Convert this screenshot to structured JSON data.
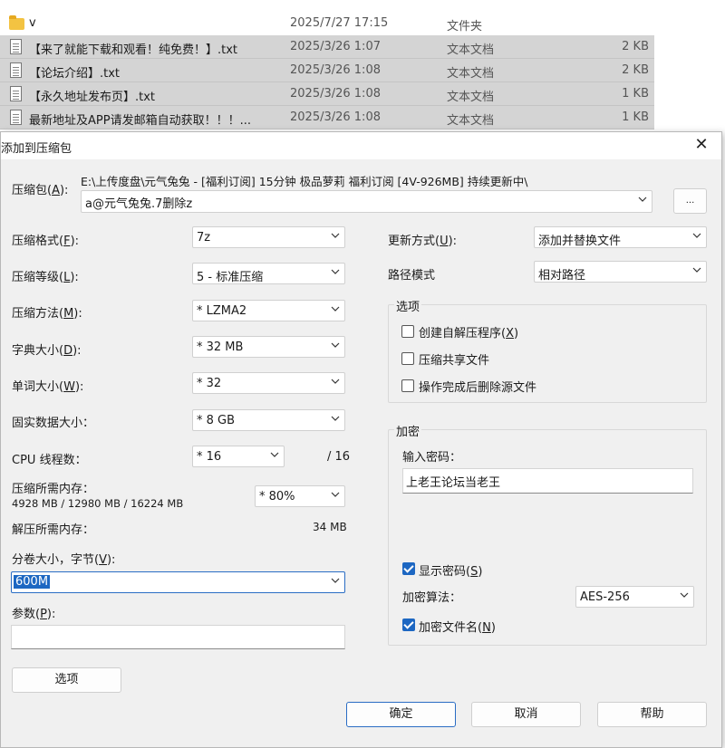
{
  "explorer": {
    "folder": {
      "name": "v",
      "date": "2025/7/27 17:15",
      "type": "文件夹",
      "size": ""
    },
    "files": [
      {
        "name": "【来了就能下载和观看！纯免费！】.txt",
        "date": "2025/3/26 1:07",
        "type": "文本文档",
        "size": "2 KB"
      },
      {
        "name": "【论坛介绍】.txt",
        "date": "2025/3/26 1:08",
        "type": "文本文档",
        "size": "2 KB"
      },
      {
        "name": "【永久地址发布页】.txt",
        "date": "2025/3/26 1:08",
        "type": "文本文档",
        "size": "1 KB"
      },
      {
        "name": "最新地址及APP请发邮箱自动获取！！！...",
        "date": "2025/3/26 1:08",
        "type": "文本文档",
        "size": "1 KB"
      }
    ]
  },
  "dialog": {
    "title": "添加到压缩包",
    "archive": {
      "label_pre": "压缩包(",
      "label_key": "A",
      "label_post": "):",
      "path": "E:\\上传度盘\\元气兔兔 - [福利订阅] 15分钟 极品萝莉 福利订阅 [4V-926MB] 持续更新中\\",
      "filename": "a@元气兔兔.7删除z",
      "browse": "..."
    },
    "left": {
      "format": {
        "label_pre": "压缩格式(",
        "label_key": "F",
        "label_post": "):",
        "value": "7z"
      },
      "level": {
        "label_pre": "压缩等级(",
        "label_key": "L",
        "label_post": "):",
        "value": "5 - 标准压缩"
      },
      "method": {
        "label_pre": "压缩方法(",
        "label_key": "M",
        "label_post": "):",
        "value": "* LZMA2"
      },
      "dict": {
        "label_pre": "字典大小(",
        "label_key": "D",
        "label_post": "):",
        "value": "* 32 MB"
      },
      "word": {
        "label_pre": "单词大小(",
        "label_key": "W",
        "label_post": "):",
        "value": "* 32"
      },
      "solid": {
        "label": "固实数据大小：",
        "value": "* 8 GB"
      },
      "threads": {
        "label": "CPU 线程数：",
        "value": "* 16",
        "max": "/ 16"
      },
      "mem_comp": {
        "label": "压缩所需内存：",
        "detail": "4928 MB / 12980 MB / 16224 MB",
        "value": "* 80%"
      },
      "mem_decomp": {
        "label": "解压所需内存：",
        "value": "34 MB"
      },
      "volume": {
        "label_pre": "分卷大小，字节(",
        "label_key": "V",
        "label_post": "):",
        "value": "600M"
      },
      "params": {
        "label_pre": "参数(",
        "label_key": "P",
        "label_post": "):",
        "value": ""
      },
      "options_button": "选项"
    },
    "right": {
      "update": {
        "label_pre": "更新方式(",
        "label_key": "U",
        "label_post": "):",
        "value": "添加并替换文件"
      },
      "pathmode": {
        "label": "路径模式",
        "value": "相对路径"
      },
      "options": {
        "title": "选项",
        "sfx": {
          "label_pre": "创建自解压程序(",
          "label_key": "X",
          "label_post": ")",
          "checked": false
        },
        "shared": {
          "label": "压缩共享文件",
          "checked": false
        },
        "delete": {
          "label": "操作完成后删除源文件",
          "checked": false
        }
      },
      "encryption": {
        "title": "加密",
        "pw_label": "输入密码：",
        "password": "上老王论坛当老王",
        "show_pw": {
          "label_pre": "显示密码(",
          "label_key": "S",
          "label_post": ")",
          "checked": true
        },
        "method_label": "加密算法：",
        "method": "AES-256",
        "enc_names": {
          "label_pre": "加密文件名(",
          "label_key": "N",
          "label_post": ")",
          "checked": true
        }
      }
    },
    "buttons": {
      "ok": "确定",
      "cancel": "取消",
      "help": "帮助"
    }
  }
}
